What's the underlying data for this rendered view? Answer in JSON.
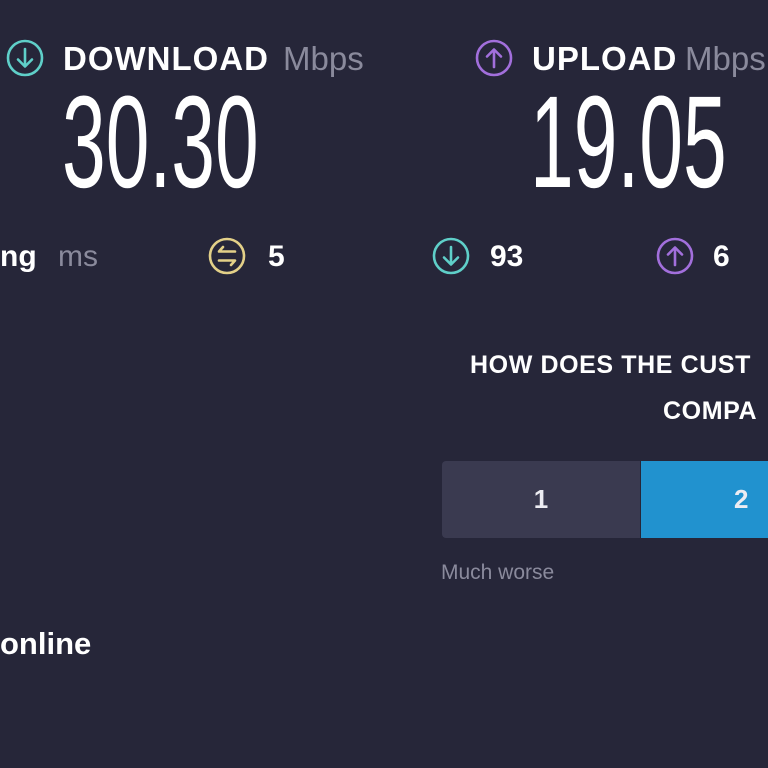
{
  "colors": {
    "background": "#262639",
    "download_accent": "#5fcfc9",
    "upload_accent": "#a26fdc",
    "jitter_accent": "#e3d088",
    "muted_text": "#8a8a9c",
    "option_bg": "#3a3a50",
    "selected_option_bg": "#2192cf"
  },
  "download": {
    "icon": "download-icon",
    "label": "DOWNLOAD",
    "unit": "Mbps",
    "value": "30.30"
  },
  "upload": {
    "icon": "upload-icon",
    "label": "UPLOAD",
    "unit": "Mbps",
    "value": "19.05"
  },
  "ping": {
    "label": "ng",
    "unit": "ms",
    "jitter_icon": "jitter-icon",
    "jitter_value": "5",
    "download_latency_icon": "download-icon",
    "download_latency_value": "93",
    "upload_latency_icon": "upload-icon",
    "upload_latency_value": "6"
  },
  "survey": {
    "question_line1": "HOW DOES THE CUST",
    "question_line2": "COMPA",
    "options": [
      "1",
      "2"
    ],
    "selected": "2",
    "low_label": "Much worse"
  },
  "status": {
    "text": "online"
  }
}
